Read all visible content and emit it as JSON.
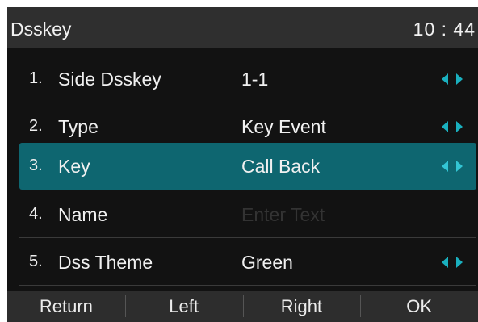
{
  "header": {
    "title": "Dsskey",
    "time": "10 : 44"
  },
  "menu": {
    "items": [
      {
        "num": "1.",
        "label": "Side Dsskey",
        "value": "1-1"
      },
      {
        "num": "2.",
        "label": "Type",
        "value": "Key Event"
      },
      {
        "num": "3.",
        "label": "Key",
        "value": "Call Back"
      },
      {
        "num": "4.",
        "label": "Name",
        "placeholder": "Enter Text"
      },
      {
        "num": "5.",
        "label": "Dss Theme",
        "value": "Green"
      }
    ]
  },
  "softkeys": {
    "return": "Return",
    "left": "Left",
    "right": "Right",
    "ok": "OK"
  },
  "colors": {
    "accent": "#1ab0bf",
    "selected_row": "#0e6670",
    "background": "#121212"
  }
}
